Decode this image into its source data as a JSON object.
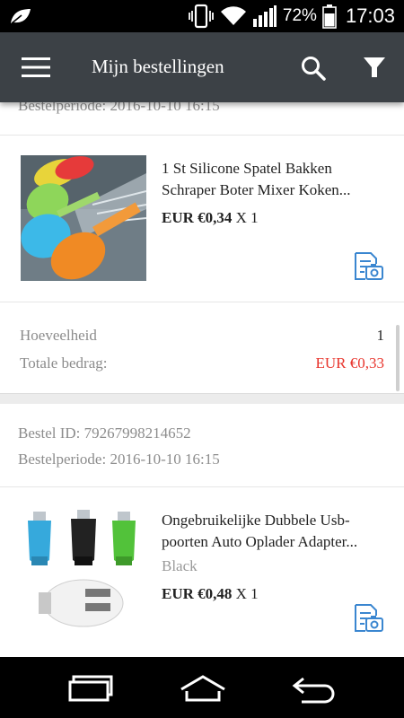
{
  "status_bar": {
    "battery": "72%",
    "time": "17:03"
  },
  "header": {
    "title": "Mijn bestellingen"
  },
  "orders": [
    {
      "period_label": "Bestelperiode:",
      "period": "2016-10-10 16:15",
      "product": {
        "title_line1": "1 St Silicone Spatel Bakken",
        "title_line2": "Schraper Boter Mixer Koken...",
        "price": "EUR €0,34",
        "qty": "X 1"
      },
      "summary": {
        "quantity_label": "Hoeveelheid",
        "quantity": "1",
        "total_label": "Totale bedrag:",
        "total": "EUR €0,33"
      }
    },
    {
      "id_label": "Bestel ID:",
      "id": "79267998214652",
      "period_label": "Bestelperiode:",
      "period": "2016-10-10 16:15",
      "product": {
        "title_line1": "Ongebruikelijke Dubbele Usb-",
        "title_line2": "poorten Auto Oplader Adapter...",
        "variant": "Black",
        "price": "EUR €0,48",
        "qty": "X 1"
      }
    }
  ],
  "colors": {
    "app_bar": "#3c4146",
    "total_red": "#e8342c",
    "icon_blue": "#3a86d0"
  }
}
